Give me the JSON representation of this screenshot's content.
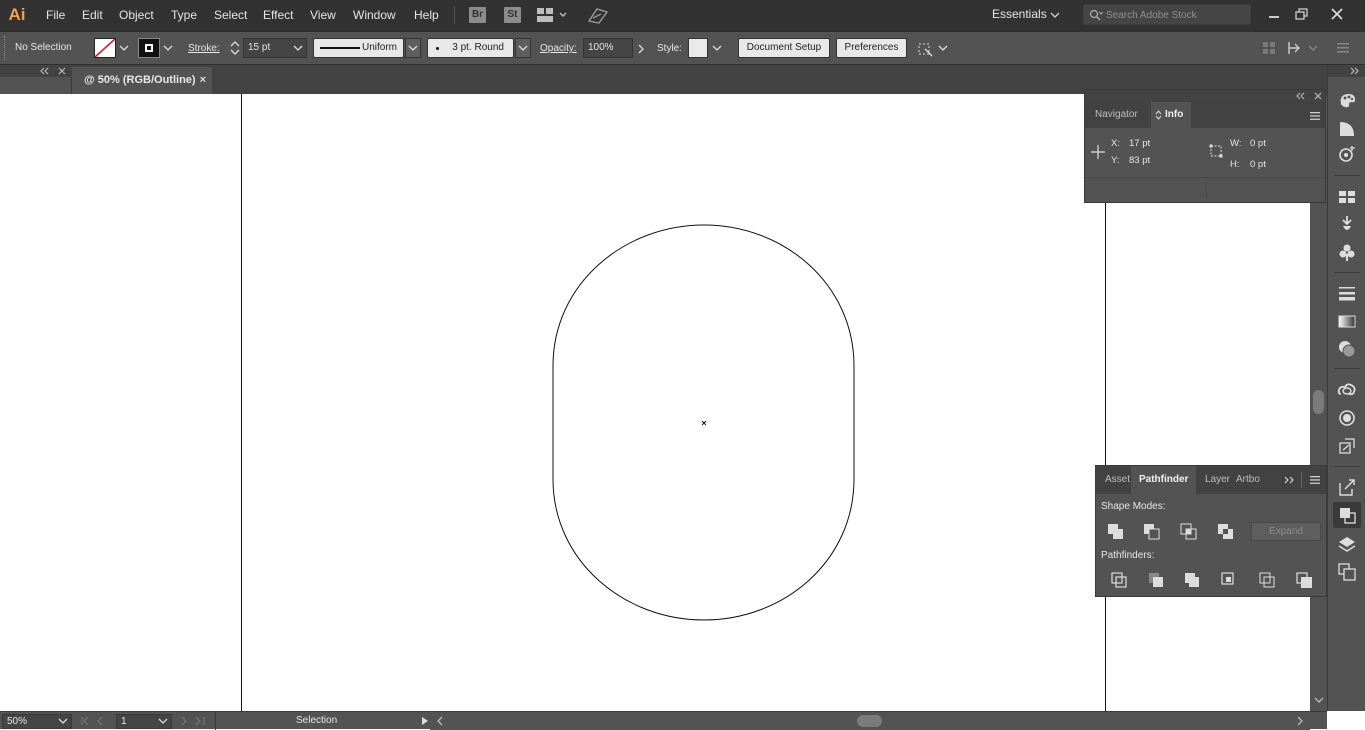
{
  "app": {
    "logo_text": "Ai",
    "menus": [
      "File",
      "Edit",
      "Object",
      "Type",
      "Select",
      "Effect",
      "View",
      "Window",
      "Help"
    ],
    "bridge_label": "Br",
    "stock_label": "St",
    "workspace": "Essentials",
    "search_placeholder": "Search Adobe Stock"
  },
  "control_bar": {
    "selection_text": "No Selection",
    "stroke_label": "Stroke:",
    "stroke_weight": "15 pt",
    "profile_label": "Uniform",
    "brush_label": "3 pt. Round",
    "opacity_label": "Opacity:",
    "opacity_value": "100%",
    "style_label": "Style:",
    "document_setup": "Document Setup",
    "preferences": "Preferences"
  },
  "document": {
    "tab_title": "@ 50% (RGB/Outline)",
    "close_symbol": "×"
  },
  "info_panel": {
    "tabs": [
      "Navigator",
      "Info"
    ],
    "x_label": "X:",
    "x_value": "17 pt",
    "y_label": "Y:",
    "y_value": "83 pt",
    "w_label": "W:",
    "w_value": "0 pt",
    "h_label": "H:",
    "h_value": "0 pt"
  },
  "pathfinder_panel": {
    "tabs": [
      "Asset",
      "Pathfinder",
      "Layer",
      "Artbo"
    ],
    "shape_modes_label": "Shape Modes:",
    "pathfinders_label": "Pathfinders:",
    "expand_label": "Expand"
  },
  "status_bar": {
    "zoom": "50%",
    "artboard": "1",
    "status": "Selection"
  },
  "colors": {
    "accent": "#f0a04e",
    "panel_bg": "#535353",
    "menubar_bg": "#323232"
  }
}
